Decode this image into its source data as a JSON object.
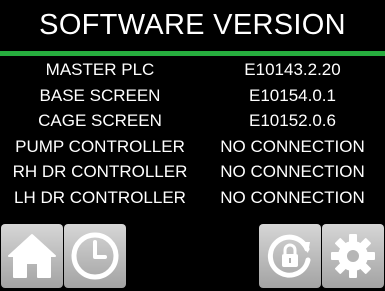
{
  "header": {
    "title": "SOFTWARE VERSION"
  },
  "colors": {
    "accent": "#27ad3e",
    "background": "#000000",
    "text": "#ffffff",
    "button": "#b8b8b8"
  },
  "versions": [
    {
      "label": "MASTER PLC",
      "value": "E10143.2.20"
    },
    {
      "label": "BASE SCREEN",
      "value": "E10154.0.1"
    },
    {
      "label": "CAGE SCREEN",
      "value": "E10152.0.6"
    },
    {
      "label": "PUMP CONTROLLER",
      "value": "NO CONNECTION"
    },
    {
      "label": "RH DR CONTROLLER",
      "value": "NO CONNECTION"
    },
    {
      "label": "LH DR CONTROLLER",
      "value": "NO CONNECTION"
    }
  ],
  "footer": {
    "buttons": [
      {
        "name": "home-button",
        "icon": "home-icon"
      },
      {
        "name": "history-button",
        "icon": "clock-icon"
      },
      {
        "name": "lock-button",
        "icon": "refresh-lock-icon"
      },
      {
        "name": "settings-button",
        "icon": "gear-icon"
      }
    ]
  }
}
